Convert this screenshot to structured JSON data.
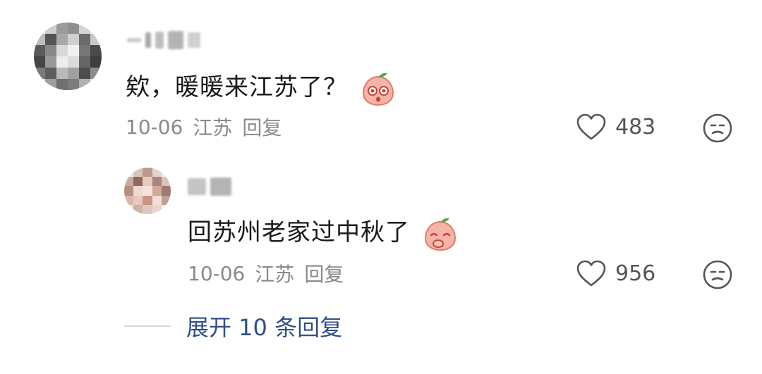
{
  "comments": [
    {
      "text": "欸，暖暖来江苏了？",
      "date": "10-06",
      "location": "江苏",
      "reply_label": "回复",
      "likes": "483",
      "emoji": "peach-surprised-emoji"
    },
    {
      "text": "回苏州老家过中秋了",
      "date": "10-06",
      "location": "江苏",
      "reply_label": "回复",
      "likes": "956",
      "emoji": "peach-shy-emoji"
    }
  ],
  "expand_label": "展开 10 条回复",
  "colors": {
    "link": "#2f4f87",
    "meta": "#8a8a8a",
    "text": "#1a1a1a",
    "peach": "#f6b3a6",
    "leaf": "#4fa847"
  }
}
